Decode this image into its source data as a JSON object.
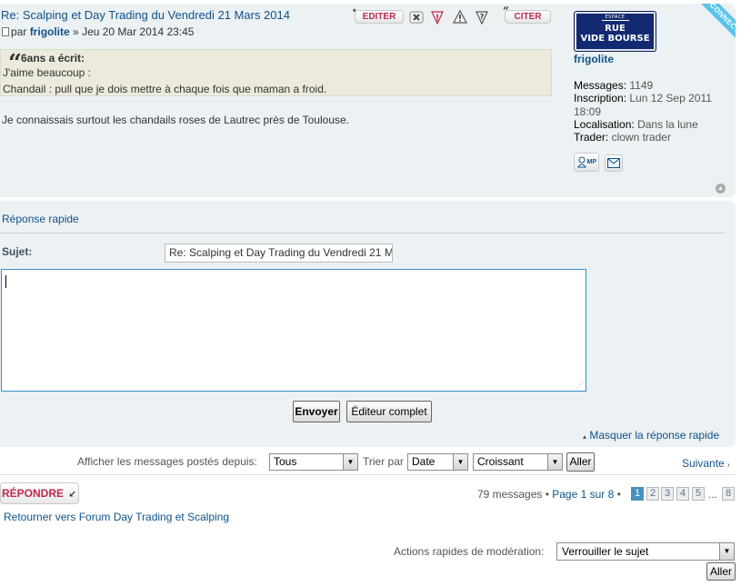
{
  "post": {
    "title": "Re: Scalping et Day Trading du Vendredi 21 Mars 2014",
    "by_prefix": "par",
    "author": "frigolite",
    "date_sep": "»",
    "date": "Jeu 20 Mar 2014 23:45",
    "buttons": {
      "edit": "EDITER",
      "quote": "CITER"
    },
    "quote": {
      "cite": "6ans a écrit:",
      "line1": "J'aime beaucoup :",
      "line2": "Chandail : pull que je dois mettre à chaque fois que maman a froid."
    },
    "body": "Je connaissais surtout les chandails roses de Lautrec près de Toulouse."
  },
  "profile": {
    "avatar": {
      "small_top": "ESPACE",
      "line1": "RUE",
      "line2": "VIDE BOURSE"
    },
    "online_label": "CONNECTÉ",
    "username": "frigolite",
    "messages_label": "Messages:",
    "messages_value": "1149",
    "inscription_label": "Inscription:",
    "inscription_value": "Lun 12 Sep 2011",
    "inscription_time": "18:09",
    "localisation_label": "Localisation:",
    "localisation_value": "Dans la lune",
    "trader_label": "Trader:",
    "trader_value": "clown trader",
    "pm_label": "MP"
  },
  "quick_reply": {
    "title": "Réponse rapide",
    "subject_label": "Sujet:",
    "subject_value": "Re: Scalping et Day Trading du Vendredi 21 M",
    "message_value": "",
    "send_button": "Envoyer",
    "full_editor_button": "Éditeur complet",
    "hide_link": "Masquer la réponse rapide"
  },
  "sort_bar": {
    "display_label": "Afficher les messages postés depuis:",
    "display_value": "Tous",
    "sort_label": "Trier par",
    "sort_value": "Date",
    "order_value": "Croissant",
    "go_button": "Aller",
    "next_link": "Suivante"
  },
  "pagination": {
    "reply_button": "RÉPONDRE",
    "summary": "79 messages • ",
    "page_text": "Page 1 sur 8",
    "bullet": " •",
    "pages": [
      "1",
      "2",
      "3",
      "4",
      "5"
    ],
    "ellipsis": "...",
    "last_page": "8",
    "back_link": "Retourner vers Forum Day Trading et Scalping"
  },
  "moderation": {
    "label": "Actions rapides de modération:",
    "selected": "Verrouiller le sujet",
    "go_button": "Aller"
  }
}
